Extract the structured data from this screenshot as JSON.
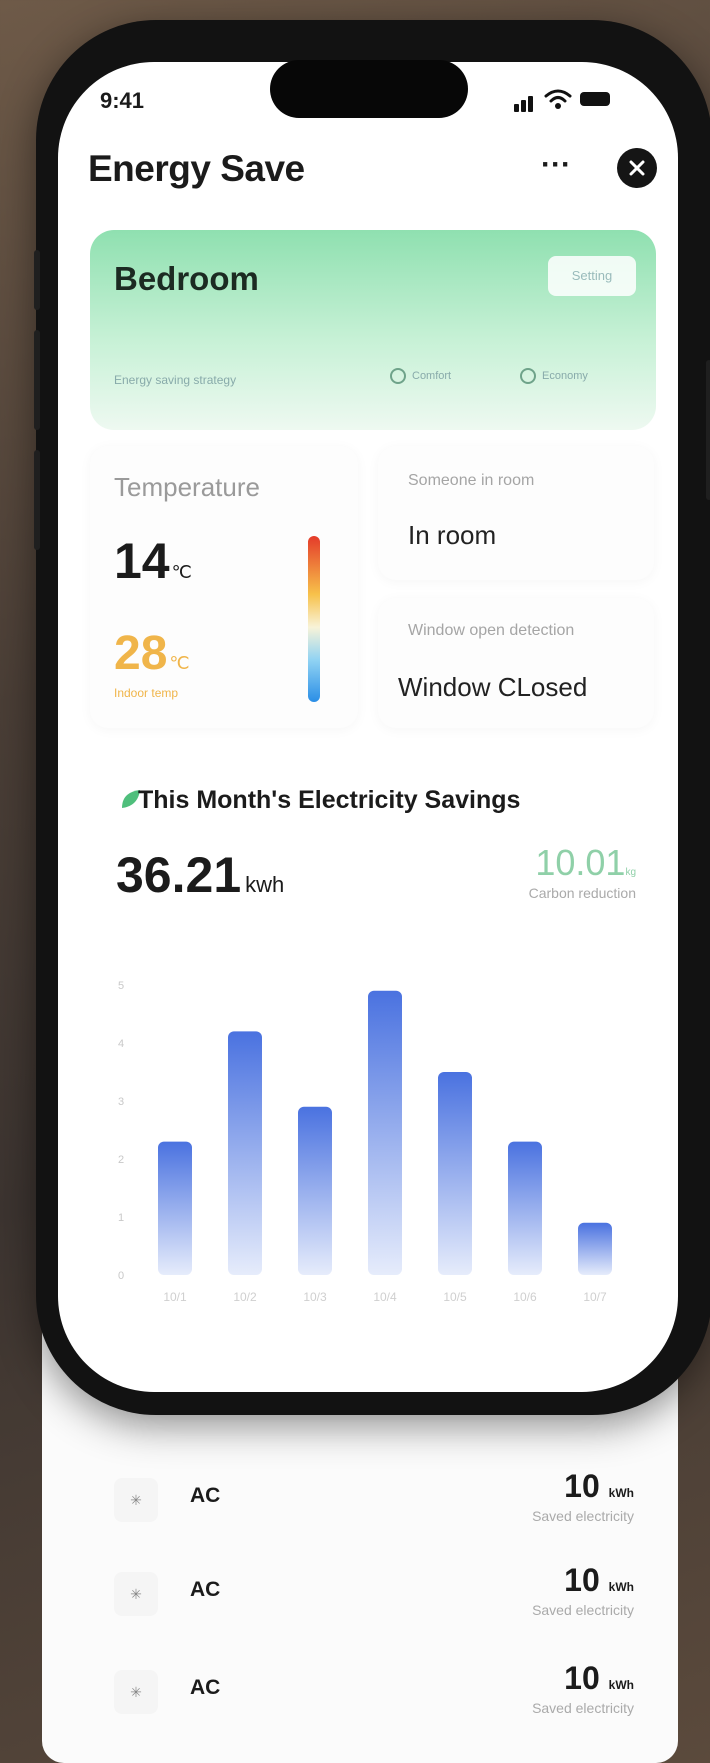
{
  "status_bar": {
    "time": "9:41"
  },
  "header": {
    "title": "Energy Save",
    "more_label": "···"
  },
  "room": {
    "name": "Bedroom",
    "setting_label": "Setting",
    "mode_label": "Energy saving strategy",
    "options": [
      "Comfort",
      "Economy"
    ]
  },
  "temperature": {
    "label": "Temperature",
    "current": "14",
    "current_unit": "℃",
    "setpoint": "28",
    "setpoint_unit": "℃",
    "setpoint_label": "Indoor temp"
  },
  "presence": {
    "label": "Someone in room",
    "value": "In room"
  },
  "window": {
    "label": "Window open detection",
    "value": "Window CLosed"
  },
  "savings": {
    "title": "This Month's Electricity Savings",
    "value": "36.21",
    "unit": "kwh",
    "carbon_value": "10.01",
    "carbon_unit": "kg",
    "carbon_label": "Carbon reduction"
  },
  "chart_data": {
    "type": "bar",
    "categories": [
      "10/1",
      "10/2",
      "10/3",
      "10/4",
      "10/5",
      "10/6",
      "10/7"
    ],
    "values": [
      2.3,
      4.2,
      2.9,
      4.9,
      3.5,
      2.3,
      0.9
    ],
    "ylim": [
      0,
      5
    ],
    "yticks": [
      "0",
      "1",
      "2",
      "3",
      "4",
      "5"
    ],
    "grid": false,
    "colors": {
      "top": "#4a72e0",
      "bottom": "#e6ecfb"
    }
  },
  "devices": [
    {
      "name": "AC",
      "value": "10",
      "unit": "kWh",
      "label": "Saved electricity"
    },
    {
      "name": "AC",
      "value": "10",
      "unit": "kWh",
      "label": "Saved electricity"
    },
    {
      "name": "AC",
      "value": "10",
      "unit": "kWh",
      "label": "Saved electricity"
    }
  ]
}
